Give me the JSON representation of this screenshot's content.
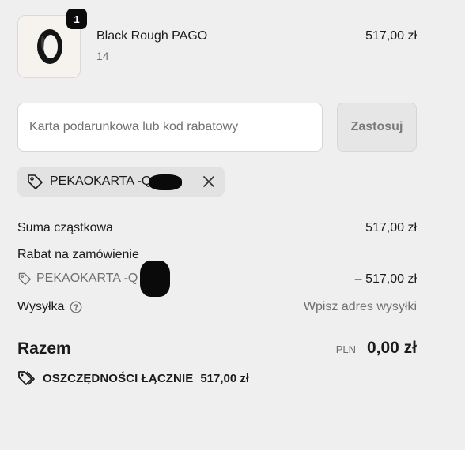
{
  "product": {
    "name": "Black Rough PAGO",
    "variant": "14",
    "price": "517,00 zł",
    "quantity": "1",
    "image_icon": "ring-icon"
  },
  "discount": {
    "placeholder": "Karta podarunkowa lub kod rabatowy",
    "value": "",
    "apply_label": "Zastosuj",
    "applied_code": "PEKAOKARTA -Q         Q"
  },
  "summary": {
    "subtotal_label": "Suma cząstkowa",
    "subtotal_value": "517,00 zł",
    "order_discount_label": "Rabat na zamówienie",
    "order_discount_code": "PEKAOKARTA -Q        Q",
    "order_discount_value": "– 517,00 zł",
    "shipping_label": "Wysyłka",
    "shipping_value": "Wpisz adres wysyłki"
  },
  "total": {
    "label": "Razem",
    "currency": "PLN",
    "value": "0,00 zł"
  },
  "savings": {
    "label": "OSZCZĘDNOŚCI ŁĄCZNIE",
    "value": "517,00 zł"
  },
  "colors": {
    "background": "#efefef",
    "muted_text": "#707070",
    "badge": "#0b0b0b"
  }
}
